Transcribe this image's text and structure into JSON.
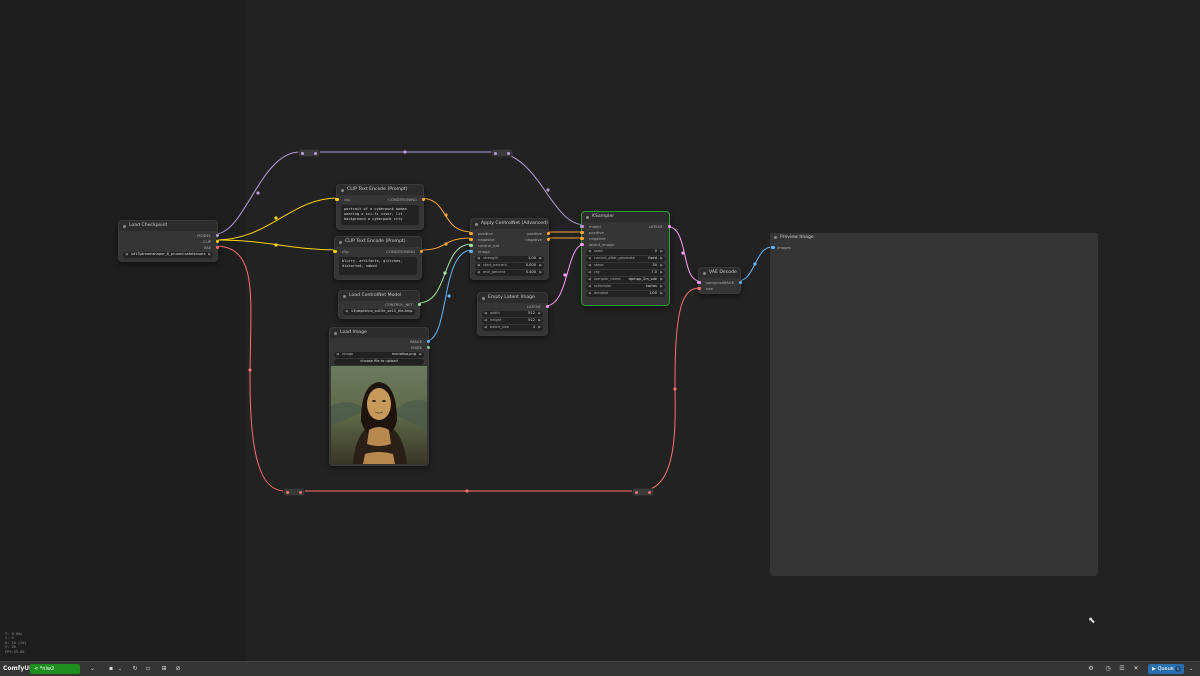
{
  "app": {
    "name": "ComfyUI",
    "workflow_tab": "*nlw2"
  },
  "colors": {
    "model": "#b39ddb",
    "clip": "#ffd500",
    "vae": "#ff6e6e",
    "conditioning": "#ffa931",
    "control_net": "#a1e9a4",
    "image": "#64b5f6",
    "latent": "#ff9cf9",
    "ksampler_border": "#2e9e2e"
  },
  "nodes": {
    "load_checkpoint": {
      "title": "Load Checkpoint",
      "outputs": [
        "MODEL",
        "CLIP",
        "VAE"
      ],
      "ckpt_name": "sd15\\dreamshaper_8_pruned.safetensors"
    },
    "clip_pos": {
      "title": "CLIP Text Encode (Prompt)",
      "input": "clip",
      "output": "CONDITIONING",
      "text": "portrait of a cyberpunk woman wearing a sci-fi visor, lit background a cyberpunk city"
    },
    "clip_neg": {
      "title": "CLIP Text Encode (Prompt)",
      "input": "clip",
      "output": "CONDITIONING",
      "text": "blurry, artifacts, glitches, distorted, naked"
    },
    "load_controlnet": {
      "title": "Load ControlNet Model",
      "output": "CONTROL_NET",
      "control_net_name": "v3\\depth\\ne_sd15e_sd15_tile.bin"
    },
    "load_image": {
      "title": "Load Image",
      "outputs": [
        "IMAGE",
        "MASK"
      ],
      "image_label": "image",
      "image_value": "monalisa.png",
      "upload_label": "choose file to upload"
    },
    "apply_controlnet": {
      "title": "Apply ControlNet (Advanced)",
      "inputs": [
        "positive",
        "negative",
        "control_net",
        "image"
      ],
      "outputs": [
        "positive",
        "negative"
      ],
      "widgets": [
        {
          "label": "strength",
          "value": "1.00"
        },
        {
          "label": "start_percent",
          "value": "0.000"
        },
        {
          "label": "end_percent",
          "value": "0.400"
        }
      ]
    },
    "empty_latent": {
      "title": "Empty Latent Image",
      "output": "LATENT",
      "widgets": [
        {
          "label": "width",
          "value": "512"
        },
        {
          "label": "height",
          "value": "512"
        },
        {
          "label": "batch_size",
          "value": "4"
        }
      ]
    },
    "ksampler": {
      "title": "KSampler",
      "inputs": [
        "model",
        "positive",
        "negative",
        "latent_image"
      ],
      "output": "LATENT",
      "widgets": [
        {
          "label": "seed",
          "value": "0"
        },
        {
          "label": "control_after_generate",
          "value": "fixed"
        },
        {
          "label": "steps",
          "value": "30"
        },
        {
          "label": "cfg",
          "value": "7.0"
        },
        {
          "label": "sampler_name",
          "value": "dpmpp_2m_sde"
        },
        {
          "label": "scheduler",
          "value": "karras"
        },
        {
          "label": "denoise",
          "value": "1.00"
        }
      ]
    },
    "vae_decode": {
      "title": "VAE Decode",
      "inputs": [
        "samples",
        "vae"
      ],
      "output": "IMAGE"
    },
    "preview_image": {
      "title": "Preview Image",
      "input": "images"
    }
  },
  "stats": [
    "T: 0.00s",
    "I: 0",
    "N: 10 [10]",
    "V: 26",
    "FPS:59.00"
  ],
  "menubar": {
    "queue_label": "Queue",
    "queue_count": "1"
  }
}
